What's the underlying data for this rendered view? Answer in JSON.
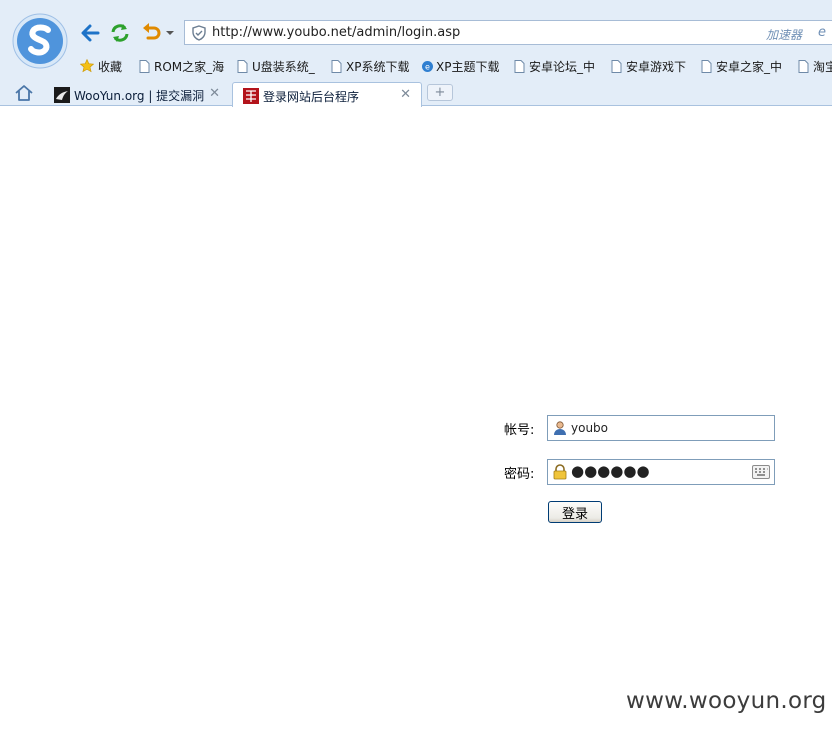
{
  "browser": {
    "address_url": "http://www.youbo.net/admin/login.asp",
    "accelerator_label": "加速器"
  },
  "bookmarks": [
    {
      "label": "收藏",
      "icon": "star-icon"
    },
    {
      "label": "ROM之家_海",
      "icon": "page-icon"
    },
    {
      "label": "U盘装系统_",
      "icon": "page-icon"
    },
    {
      "label": "XP系统下载",
      "icon": "page-icon"
    },
    {
      "label": "XP主题下载",
      "icon": "globe-icon"
    },
    {
      "label": "安卓论坛_中",
      "icon": "page-icon"
    },
    {
      "label": "安卓游戏下",
      "icon": "page-icon"
    },
    {
      "label": "安卓之家_中",
      "icon": "page-icon"
    },
    {
      "label": "淘宝",
      "icon": "page-icon"
    }
  ],
  "tabs": [
    {
      "title": "WooYun.org | 提交漏洞",
      "active": false
    },
    {
      "title": "登录网站后台程序",
      "active": true
    }
  ],
  "login": {
    "account_label": "帐号:",
    "account_value": "youbo",
    "password_label": "密码:",
    "password_value": "●●●●●●",
    "submit_label": "登录"
  },
  "watermark": "www.wooyun.org",
  "colors": {
    "chrome_bg": "#e3edf8",
    "nav_blue": "#1e73c8",
    "refresh_green": "#2da12d",
    "undo_orange": "#e08a00"
  }
}
